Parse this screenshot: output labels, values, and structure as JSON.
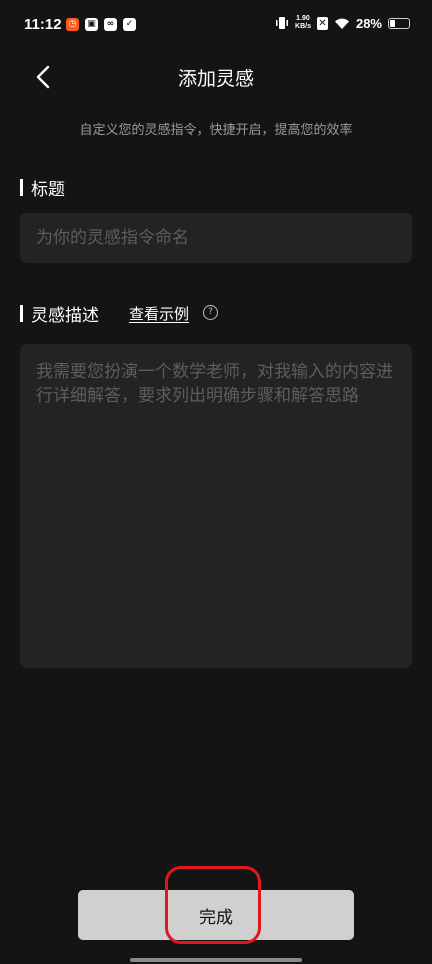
{
  "status_bar": {
    "time": "11:12",
    "net_speed_value": "1.90",
    "net_speed_unit": "KB/s",
    "battery": "28%",
    "battery_level": 0.28,
    "notification_icons": [
      "app-notification-icon",
      "shop-notification-icon",
      "link-notification-icon",
      "message-notification-icon"
    ]
  },
  "header": {
    "title": "添加灵感",
    "subtitle": "自定义您的灵感指令，快捷开启，提高您的效率"
  },
  "form": {
    "title_label": "标题",
    "title_placeholder": "为你的灵感指令命名",
    "title_value": "",
    "desc_label": "灵感描述",
    "example_link": "查看示例",
    "desc_placeholder": "我需要您扮演一个数学老师，对我输入的内容进行详细解答，要求列出明确步骤和解答思路",
    "desc_value": ""
  },
  "footer": {
    "done_label": "完成"
  },
  "colors": {
    "background": "#141414",
    "input_bg": "#232323",
    "button_bg": "#d0d0d0",
    "highlight": "#e0181e"
  }
}
